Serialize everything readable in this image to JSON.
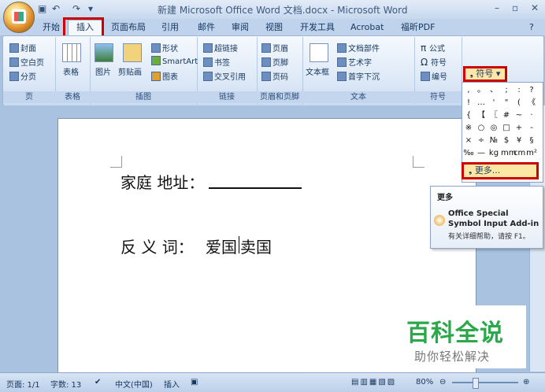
{
  "window": {
    "title": "新建 Microsoft Office Word 文档.docx - Microsoft Word",
    "minimize": "–",
    "restore": "▫",
    "close": "✕",
    "help": "?"
  },
  "qat": {
    "save": "▣",
    "undo": "↶",
    "redo": "↷",
    "customize": "▾"
  },
  "tabs": [
    "开始",
    "插入",
    "页面布局",
    "引用",
    "邮件",
    "审阅",
    "视图",
    "开发工具",
    "Acrobat",
    "福昕PDF"
  ],
  "ribbon": {
    "pages": {
      "label": "页",
      "items": [
        "封面",
        "空白页",
        "分页"
      ]
    },
    "table": {
      "label": "表格",
      "button": "表格"
    },
    "illustrations": {
      "label": "插图",
      "picture": "图片",
      "clipart": "剪贴画",
      "shapes": "形状",
      "smartart": "SmartArt",
      "chart": "图表"
    },
    "links": {
      "label": "链接",
      "items": [
        "超链接",
        "书签",
        "交叉引用"
      ]
    },
    "header_footer": {
      "label": "页眉和页脚",
      "items": [
        "页眉",
        "页脚",
        "页码"
      ]
    },
    "text": {
      "label": "文本",
      "textbox": "文本框",
      "items": [
        "文档部件",
        "艺术字",
        "首字下沉"
      ]
    },
    "symbols": {
      "label": "符号",
      "equation": "公式",
      "symbol": "符号",
      "number": "编号"
    }
  },
  "symbol_dropdown": {
    "button_label": "符号",
    "symbols": [
      ",",
      "。",
      "、",
      ";",
      ":",
      "?",
      "!",
      "…",
      "'",
      "\"",
      "(",
      "《",
      "{",
      "【",
      "〖",
      "#",
      "~",
      "·",
      "※",
      "○",
      "◎",
      "□",
      "+",
      "-",
      "×",
      "÷",
      "№",
      "$",
      "¥",
      "§",
      "‰",
      "—",
      "kg",
      "mm",
      "cm",
      "m²"
    ],
    "more_label": "更多..."
  },
  "tooltip": {
    "title": "更多",
    "heading": "Office Special Symbol Input Add-in",
    "body": "有关详细帮助，请按 F1。"
  },
  "document": {
    "line1_label": "家庭 地址：",
    "line2_label": "反 义 词：",
    "line2_value_a": "爱国",
    "line2_value_b": "卖国"
  },
  "watermark": {
    "brand": "百科全说",
    "slogan": "助你轻松解决"
  },
  "status": {
    "page": "页面: 1/1",
    "words": "字数: 13",
    "language": "中文(中国)",
    "mode": "插入",
    "zoom": "80%"
  }
}
